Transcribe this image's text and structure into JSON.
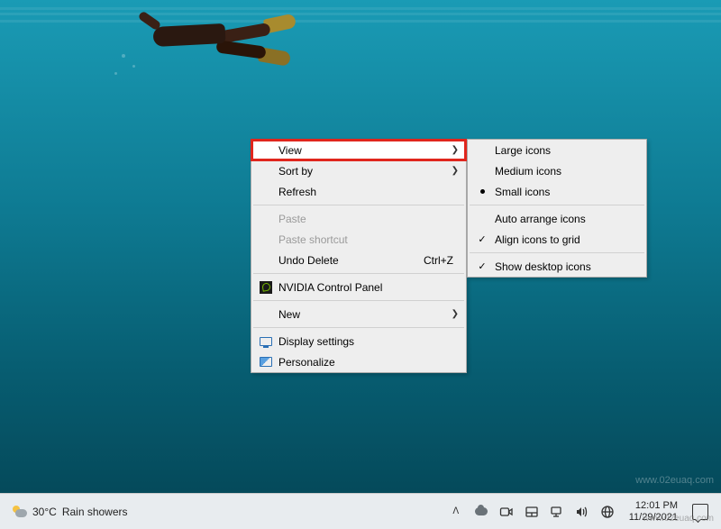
{
  "context_menu": {
    "view": {
      "label": "View",
      "has_submenu": true,
      "highlighted": true
    },
    "sort_by": {
      "label": "Sort by",
      "has_submenu": true
    },
    "refresh": {
      "label": "Refresh"
    },
    "paste": {
      "label": "Paste",
      "disabled": true
    },
    "paste_shortcut": {
      "label": "Paste shortcut",
      "disabled": true
    },
    "undo_delete": {
      "label": "Undo Delete",
      "hotkey": "Ctrl+Z"
    },
    "nvidia": {
      "label": "NVIDIA Control Panel"
    },
    "new": {
      "label": "New",
      "has_submenu": true
    },
    "display_settings": {
      "label": "Display settings"
    },
    "personalize": {
      "label": "Personalize"
    }
  },
  "view_submenu": {
    "large_icons": {
      "label": "Large icons"
    },
    "medium_icons": {
      "label": "Medium icons"
    },
    "small_icons": {
      "label": "Small icons",
      "selected": true
    },
    "auto_arrange": {
      "label": "Auto arrange icons"
    },
    "align_grid": {
      "label": "Align icons to grid",
      "checked": true
    },
    "show_desktop": {
      "label": "Show desktop icons",
      "checked": true
    }
  },
  "taskbar": {
    "weather_temp": "30°C",
    "weather_text": "Rain showers",
    "time": "12:01 PM",
    "date": "11/29/2021"
  },
  "watermark": "www.02euaq.com"
}
